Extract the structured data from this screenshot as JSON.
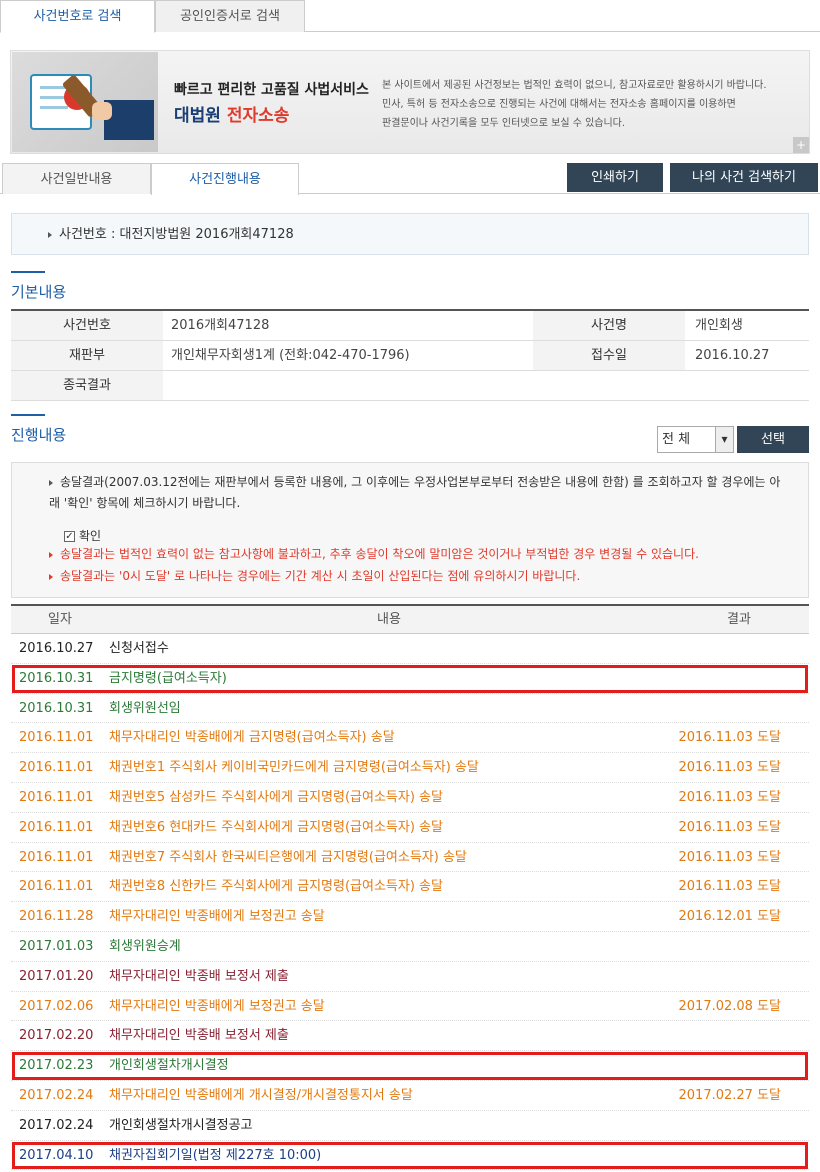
{
  "search_tabs": [
    "사건번호로 검색",
    "공인인증서로 검색"
  ],
  "banner": {
    "tagline": "빠르고 편리한 고품질 사법서비스",
    "brand_main": "대법원",
    "brand_accent": "전자소송",
    "notice_lines": [
      "본 사이트에서 제공된 사건정보는 법적인 효력이 없으니, 참고자료로만 활용하시기 바랍니다.",
      "민사, 특허 등 전자소송으로 진행되는 사건에 대해서는 전자소송 홈페이지를 이용하면",
      "판결문이나 사건기록을 모두 인터넷으로 보실 수 있습니다."
    ],
    "plus": "+"
  },
  "sub_tabs": [
    "사건일반내용",
    "사건진행내용"
  ],
  "buttons": {
    "print": "인쇄하기",
    "my_search": "나의 사건 검색하기",
    "select": "선택"
  },
  "case_number_line": "사건번호 : 대전지방법원 2016개회47128",
  "sections": {
    "basic": "기본내용",
    "progress": "진행내용"
  },
  "basic_info": {
    "case_no_label": "사건번호",
    "case_no": "2016개회47128",
    "case_name_label": "사건명",
    "case_name": "개인회생",
    "court_label": "재판부",
    "court": "개인채무자회생1계 (전화:042-470-1796)",
    "received_label": "접수일",
    "received": "2016.10.27",
    "final_label": "종국결과",
    "final": ""
  },
  "filter": {
    "selected": "전 체",
    "arrow": "▾"
  },
  "notice": {
    "line1": "송달결과(2007.03.12전에는 재판부에서 등록한 내용에, 그 이후에는 우정사업본부로부터 전송받은 내용에 한함) 를 조회하고자 할 경우에는 아래 '확인' 항목에 체크하시기 바랍니다.",
    "confirm_label": "확인",
    "check_mark": "✓",
    "line2": "송달결과는 법적인 효력이 없는 참고사항에 불과하고, 추후 송달이 착오에 말미암은 것이거나 부적법한 경우 변경될 수 있습니다.",
    "line3": "송달결과는 '0시 도달' 로 나타나는 경우에는 기간 계산 시 초일이 산입된다는 점에 유의하시기 바랍니다."
  },
  "progress_headers": {
    "date": "일자",
    "desc": "내용",
    "result": "결과"
  },
  "progress_rows": [
    {
      "date": "2016.10.27",
      "desc": "신청서접수",
      "result": "",
      "color": "black",
      "highlight": false
    },
    {
      "date": "2016.10.31",
      "desc": "금지명령(급여소득자)",
      "result": "",
      "color": "green",
      "highlight": true
    },
    {
      "date": "2016.10.31",
      "desc": "회생위원선임",
      "result": "",
      "color": "green",
      "highlight": false
    },
    {
      "date": "2016.11.01",
      "desc": "채무자대리인 박종배에게 금지명령(급여소득자) 송달",
      "result": "2016.11.03 도달",
      "color": "orange",
      "highlight": false
    },
    {
      "date": "2016.11.01",
      "desc": "채권번호1 주식회사 케이비국민카드에게 금지명령(급여소득자) 송달",
      "result": "2016.11.03 도달",
      "color": "orange",
      "highlight": false
    },
    {
      "date": "2016.11.01",
      "desc": "채권번호5 삼성카드 주식회사에게 금지명령(급여소득자) 송달",
      "result": "2016.11.03 도달",
      "color": "orange",
      "highlight": false
    },
    {
      "date": "2016.11.01",
      "desc": "채권번호6 현대카드 주식회사에게 금지명령(급여소득자) 송달",
      "result": "2016.11.03 도달",
      "color": "orange",
      "highlight": false
    },
    {
      "date": "2016.11.01",
      "desc": "채권번호7 주식회사 한국씨티은행에게 금지명령(급여소득자) 송달",
      "result": "2016.11.03 도달",
      "color": "orange",
      "highlight": false
    },
    {
      "date": "2016.11.01",
      "desc": "채권번호8 신한카드 주식회사에게 금지명령(급여소득자) 송달",
      "result": "2016.11.03 도달",
      "color": "orange",
      "highlight": false
    },
    {
      "date": "2016.11.28",
      "desc": "채무자대리인 박종배에게 보정권고 송달",
      "result": "2016.12.01 도달",
      "color": "orange",
      "highlight": false
    },
    {
      "date": "2017.01.03",
      "desc": "회생위원승계",
      "result": "",
      "color": "green",
      "highlight": false
    },
    {
      "date": "2017.01.20",
      "desc": "채무자대리인 박종배 보정서 제출",
      "result": "",
      "color": "maroon",
      "highlight": false
    },
    {
      "date": "2017.02.06",
      "desc": "채무자대리인 박종배에게 보정권고 송달",
      "result": "2017.02.08 도달",
      "color": "orange",
      "highlight": false
    },
    {
      "date": "2017.02.20",
      "desc": "채무자대리인 박종배 보정서 제출",
      "result": "",
      "color": "maroon",
      "highlight": false
    },
    {
      "date": "2017.02.23",
      "desc": "개인회생절차개시결정",
      "result": "",
      "color": "green",
      "highlight": true
    },
    {
      "date": "2017.02.24",
      "desc": "채무자대리인 박종배에게 개시결정/개시결정통지서 송달",
      "result": "2017.02.27 도달",
      "color": "orange",
      "highlight": false
    },
    {
      "date": "2017.02.24",
      "desc": "개인회생절차개시결정공고",
      "result": "",
      "color": "black",
      "highlight": false
    },
    {
      "date": "2017.04.10",
      "desc": "채권자집회기일(법정 제227호 10:00)",
      "result": "",
      "color": "navy",
      "highlight": true
    }
  ],
  "colors": {
    "brand_blue": "#1e5fa8",
    "dark_button": "#314556",
    "alert_red": "#e03a2c",
    "highlight_red": "#e51c1c"
  }
}
